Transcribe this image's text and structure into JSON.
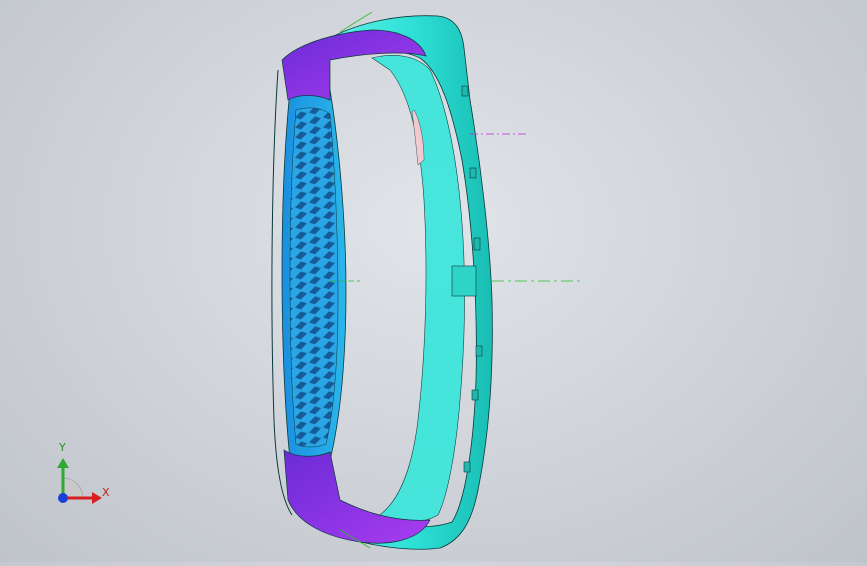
{
  "viewport": {
    "background_top": "#e1e4e9",
    "background_bottom": "#bfc3ca"
  },
  "model": {
    "colors": {
      "outer_shell": "#2ee0d6",
      "inner_shell": "#1fa3e0",
      "side_panel": "#8a2be2",
      "grille": "#1e7fcf",
      "edge_lines": "#0a3a3a"
    }
  },
  "triad": {
    "x_label": "X",
    "y_label": "Y",
    "x_color": "#d62020",
    "y_color": "#2ea82e",
    "z_color": "#1a3fd6"
  }
}
